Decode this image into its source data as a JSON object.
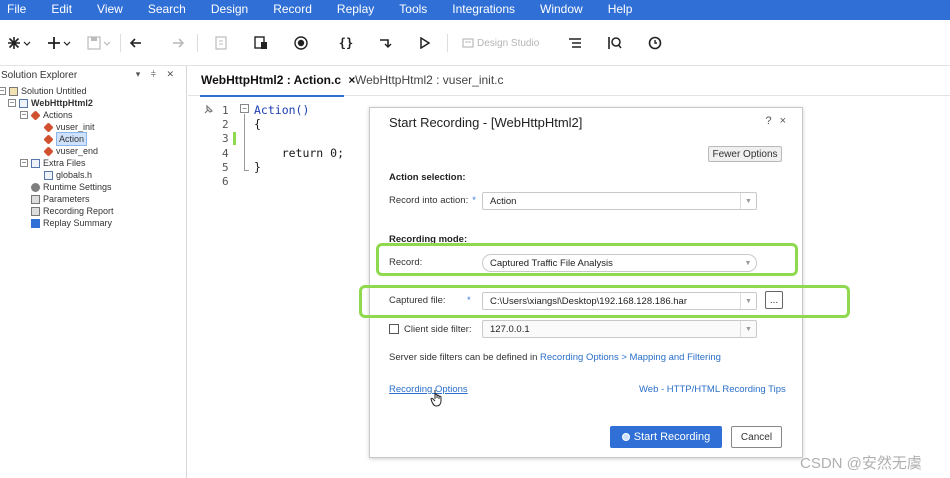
{
  "menu": [
    "File",
    "Edit",
    "View",
    "Search",
    "Design",
    "Record",
    "Replay",
    "Tools",
    "Integrations",
    "Window",
    "Help"
  ],
  "toolbar": {
    "design_studio_label": "Design Studio"
  },
  "explorer": {
    "title": "Solution Explorer",
    "solution": "Solution Untitled",
    "script": "WebHttpHtml2",
    "actions_folder": "Actions",
    "action_init": "vuser_init",
    "action_main": "Action",
    "action_end": "vuser_end",
    "extra_folder": "Extra Files",
    "extra_globals": "globals.h",
    "runtime": "Runtime Settings",
    "parameters": "Parameters",
    "recording_report": "Recording Report",
    "replay_summary": "Replay Summary"
  },
  "tabs": [
    {
      "label": "WebHttpHtml2 : Action.c",
      "close": "×"
    },
    {
      "label": "WebHttpHtml2 : vuser_init.c"
    }
  ],
  "code": {
    "line_numbers": [
      "1",
      "2",
      "3",
      "4",
      "5",
      "6"
    ],
    "lines": [
      "Action()",
      "{",
      "",
      "    return 0;",
      "}",
      ""
    ]
  },
  "dialog": {
    "title": "Start Recording - [WebHttpHtml2]",
    "help": "?",
    "close": "×",
    "fewer_options": "Fewer Options",
    "action_selection_heading": "Action selection:",
    "record_into_label": "Record into action:",
    "record_into_value": "Action",
    "recording_mode_heading": "Recording mode:",
    "record_label": "Record:",
    "record_value": "Captured Traffic File Analysis",
    "captured_file_label": "Captured file:",
    "captured_file_value": "C:\\Users\\xiangsl\\Desktop\\192.168.128.186.har",
    "browse": "...",
    "client_filter_label": "Client side filter:",
    "client_filter_value": "127.0.0.1",
    "server_filter_text": "Server side filters can be defined in",
    "server_filter_link": "Recording Options > Mapping and Filtering",
    "recording_options_link": "Recording Options",
    "tips_link": "Web - HTTP/HTML Recording Tips",
    "start_recording": "Start Recording",
    "cancel": "Cancel",
    "required_mark": "*"
  },
  "watermark": "CSDN @安然无虞",
  "colors": {
    "accent": "#2f6fd6",
    "highlight": "#8fd94f",
    "link": "#2a6fc9"
  }
}
